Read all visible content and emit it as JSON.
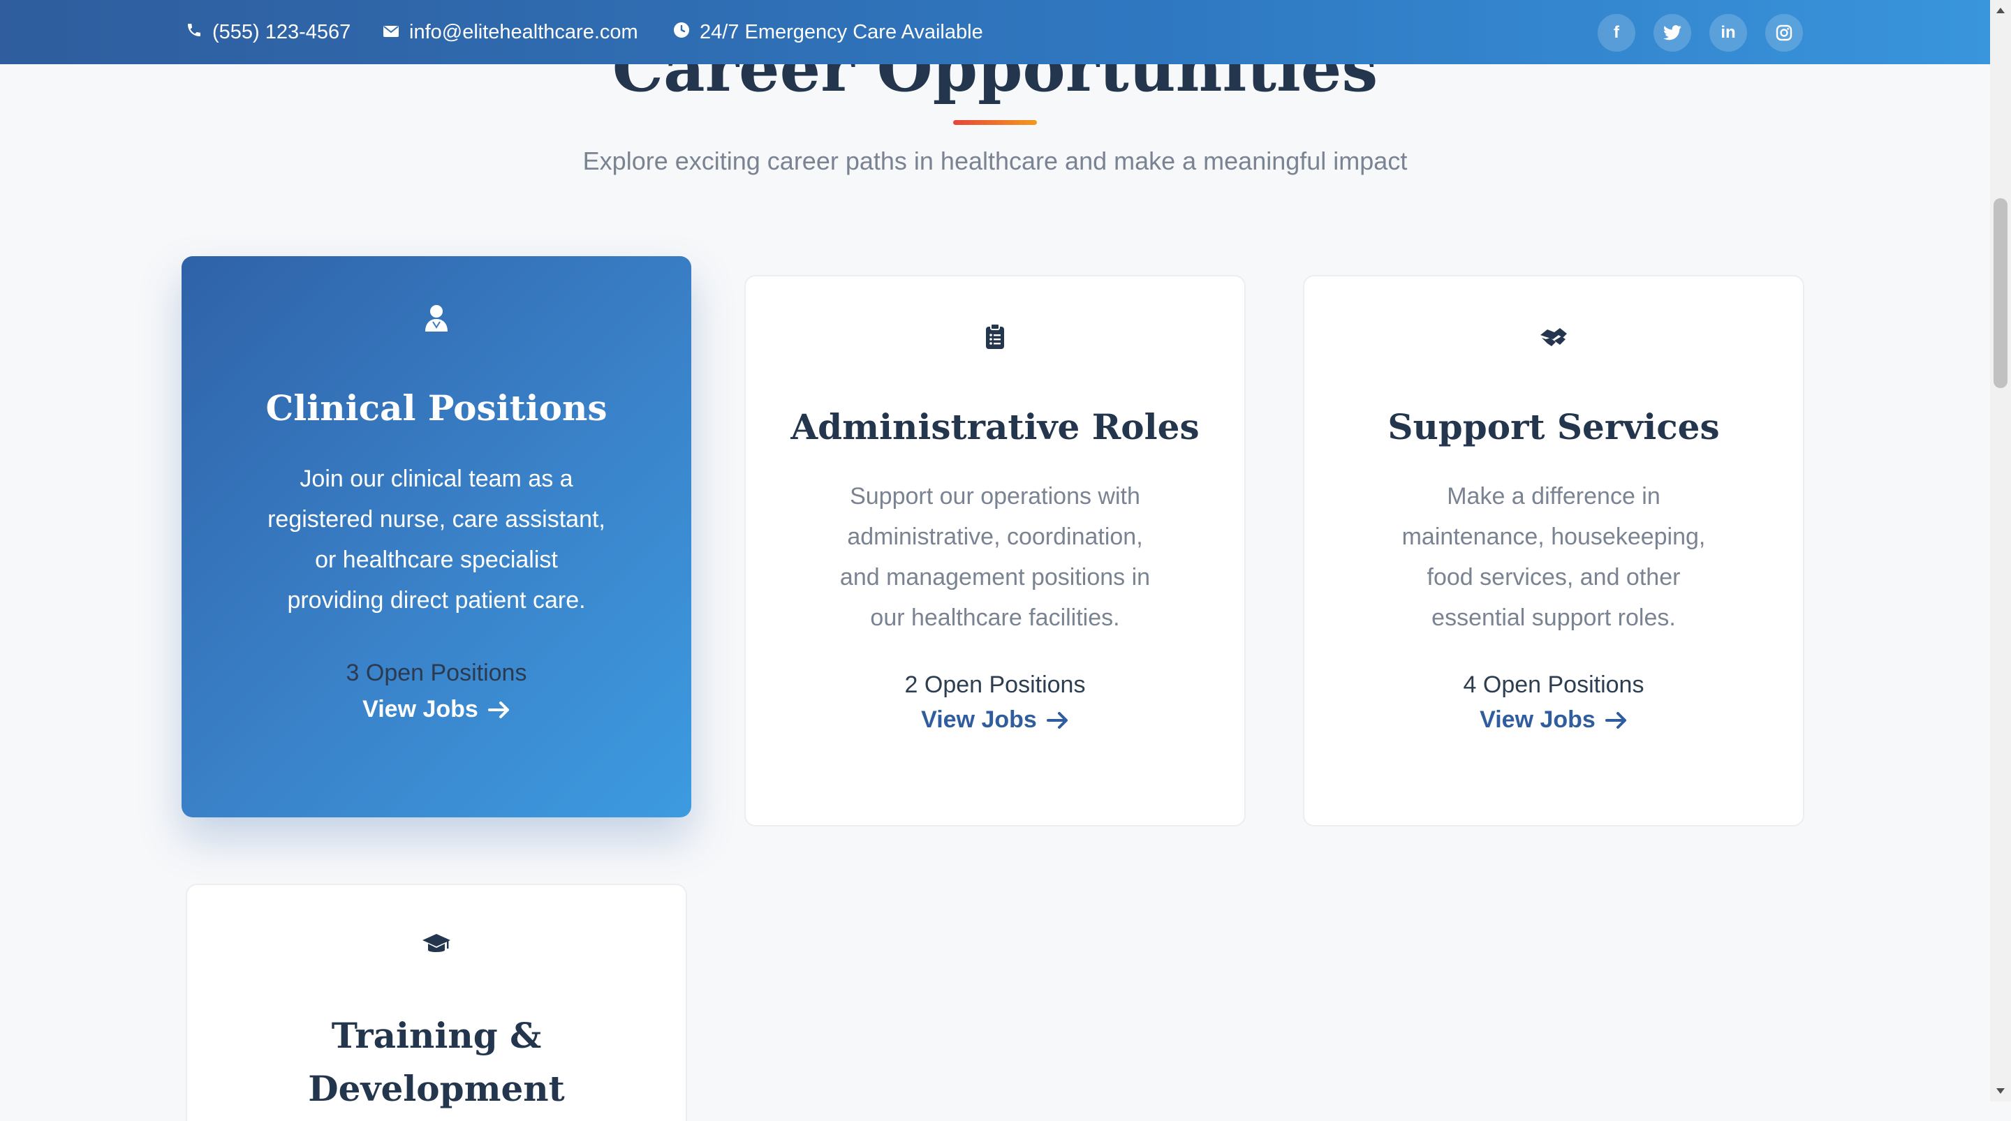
{
  "topbar": {
    "phone": "(555) 123-4567",
    "email": "info@elitehealthcare.com",
    "emergency": "24/7 Emergency Care Available",
    "social": [
      {
        "icon": "facebook-icon",
        "glyph": "f"
      },
      {
        "icon": "twitter-icon",
        "glyph": "t"
      },
      {
        "icon": "linkedin-icon",
        "glyph": "in"
      },
      {
        "icon": "instagram-icon",
        "glyph": "ig"
      }
    ]
  },
  "section": {
    "title": "Career Opportunities",
    "subtitle": "Explore exciting career paths in healthcare and make a meaningful impact"
  },
  "cards": [
    {
      "icon": "user-doctor-icon",
      "title": "Clinical Positions",
      "description": "Join our clinical team as a registered nurse, care assistant, or healthcare specialist providing direct patient care.",
      "count": "3 Open Positions",
      "link": "View Jobs",
      "active": true
    },
    {
      "icon": "clipboard-list-icon",
      "title": "Administrative Roles",
      "description": "Support our operations with administrative, coordination, and management positions in our healthcare facilities.",
      "count": "2 Open Positions",
      "link": "View Jobs",
      "active": false
    },
    {
      "icon": "handshake-icon",
      "title": "Support Services",
      "description": "Make a difference in maintenance, housekeeping, food services, and other essential support roles.",
      "count": "4 Open Positions",
      "link": "View Jobs",
      "active": false
    },
    {
      "icon": "graduation-cap-icon",
      "title": "Training & Development",
      "active": false
    }
  ],
  "colors": {
    "primary": "#2f5d9d",
    "accent_gradient_start": "#e6463a",
    "accent_gradient_end": "#f39a1e",
    "heading": "#23364d",
    "muted_text": "#7a8391"
  }
}
